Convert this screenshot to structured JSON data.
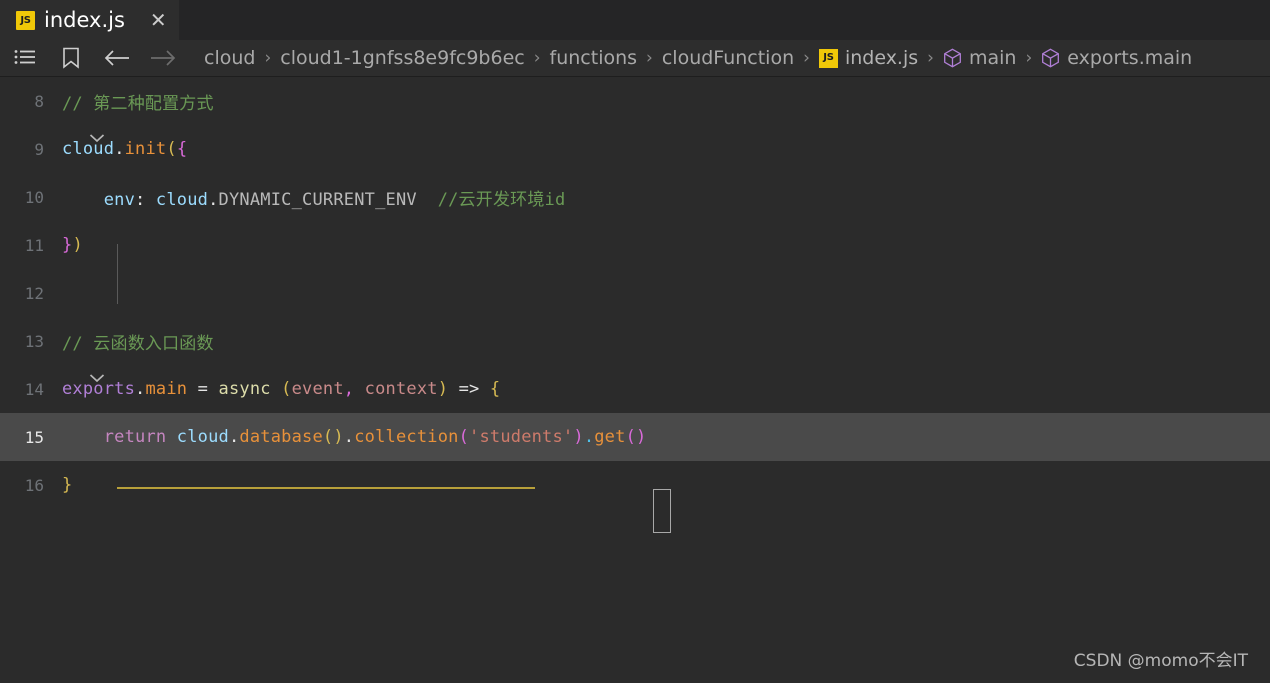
{
  "window": {
    "theme_bg": "#1e1e1e",
    "editor_bg": "#2b2b2b",
    "active_line_bg": "#4a4a4a",
    "accent": "#f0c808"
  },
  "tabbar": {
    "tabs": [
      {
        "label": "index.js",
        "badge": "JS",
        "close_glyph": "✕",
        "active": true
      }
    ]
  },
  "toolbar": {
    "outline_icon_name": "list-outline-icon",
    "bookmark_icon_name": "bookmark-icon",
    "back_icon_name": "arrow-left-icon",
    "forward_icon_name": "arrow-right-icon"
  },
  "breadcrumb": {
    "separator": "›",
    "items": [
      {
        "label": "cloud",
        "icon": "none"
      },
      {
        "label": "cloud1-1gnfss8e9fc9b6ec",
        "icon": "none"
      },
      {
        "label": "functions",
        "icon": "none"
      },
      {
        "label": "cloudFunction",
        "icon": "none"
      },
      {
        "label": "index.js",
        "icon": "js-badge",
        "badge": "JS"
      },
      {
        "label": "main",
        "icon": "cube-symbol"
      },
      {
        "label": "exports.main",
        "icon": "cube-symbol"
      }
    ]
  },
  "editor": {
    "first_visible_line": 8,
    "active_line": 15,
    "cursor_line": 15,
    "lines": [
      {
        "num": "8",
        "fold": false,
        "active": false,
        "tokens": [
          {
            "t": "// 第二种配置方式",
            "c": "t-comment"
          }
        ],
        "indent": 2
      },
      {
        "num": "9",
        "fold": true,
        "active": false,
        "tokens": [
          {
            "t": "cloud",
            "c": "t-var"
          },
          {
            "t": ".",
            "c": "t-white"
          },
          {
            "t": "init",
            "c": "t-method"
          },
          {
            "t": "(",
            "c": "t-paren-y"
          },
          {
            "t": "{",
            "c": "t-paren-p"
          }
        ],
        "indent": 0
      },
      {
        "num": "10",
        "fold": false,
        "active": false,
        "tokens": [
          {
            "t": "    env",
            "c": "t-var"
          },
          {
            "t": ": ",
            "c": "t-white"
          },
          {
            "t": "cloud",
            "c": "t-var"
          },
          {
            "t": ".",
            "c": "t-white"
          },
          {
            "t": "DYNAMIC_CURRENT_ENV",
            "c": "t-prop"
          },
          {
            "t": "  ",
            "c": "t-plain"
          },
          {
            "t": "//云开发环境id",
            "c": "t-comment"
          }
        ],
        "indent": 0
      },
      {
        "num": "11",
        "fold": false,
        "active": false,
        "tokens": [
          {
            "t": "}",
            "c": "t-paren-p"
          },
          {
            "t": ")",
            "c": "t-paren-y"
          }
        ],
        "indent": 0
      },
      {
        "num": "12",
        "fold": false,
        "active": false,
        "tokens": [],
        "indent": 0
      },
      {
        "num": "13",
        "fold": false,
        "active": false,
        "tokens": [
          {
            "t": "// 云函数入口函数",
            "c": "t-comment"
          }
        ],
        "indent": 0
      },
      {
        "num": "14",
        "fold": true,
        "active": false,
        "tokens": [
          {
            "t": "exports",
            "c": "t-purple"
          },
          {
            "t": ".",
            "c": "t-white"
          },
          {
            "t": "main",
            "c": "t-method"
          },
          {
            "t": " = ",
            "c": "t-white"
          },
          {
            "t": "async",
            "c": "t-fn"
          },
          {
            "t": " ",
            "c": "t-plain"
          },
          {
            "t": "(",
            "c": "t-paren-y"
          },
          {
            "t": "event",
            "c": "t-param"
          },
          {
            "t": ",",
            "c": "t-paren-p"
          },
          {
            "t": " ",
            "c": "t-plain"
          },
          {
            "t": "context",
            "c": "t-param"
          },
          {
            "t": ")",
            "c": "t-paren-y"
          },
          {
            "t": " ",
            "c": "t-plain"
          },
          {
            "t": "=>",
            "c": "t-white"
          },
          {
            "t": " ",
            "c": "t-plain"
          },
          {
            "t": "{",
            "c": "t-paren-y"
          }
        ],
        "indent": 0
      },
      {
        "num": "15",
        "fold": false,
        "active": true,
        "tokens": [
          {
            "t": "    return",
            "c": "t-kw2"
          },
          {
            "t": " ",
            "c": "t-plain"
          },
          {
            "t": "cloud",
            "c": "t-var"
          },
          {
            "t": ".",
            "c": "t-white"
          },
          {
            "t": "database",
            "c": "t-method"
          },
          {
            "t": "(",
            "c": "t-paren-y"
          },
          {
            "t": ")",
            "c": "t-paren-y"
          },
          {
            "t": ".",
            "c": "t-white"
          },
          {
            "t": "collection",
            "c": "t-method"
          },
          {
            "t": "(",
            "c": "t-paren-p"
          },
          {
            "t": "'students'",
            "c": "t-str"
          },
          {
            "t": ")",
            "c": "t-paren-p"
          },
          {
            "t": ".",
            "c": "t-paren-b"
          },
          {
            "t": "get",
            "c": "t-method"
          },
          {
            "t": "(",
            "c": "t-paren-p"
          },
          {
            "t": ")",
            "c": "t-paren-p"
          }
        ],
        "indent": 0
      },
      {
        "num": "16",
        "fold": false,
        "active": false,
        "tokens": [
          {
            "t": "}",
            "c": "t-paren-y"
          }
        ],
        "indent": 0
      }
    ]
  },
  "watermark": {
    "text": "CSDN @momo不会IT"
  }
}
